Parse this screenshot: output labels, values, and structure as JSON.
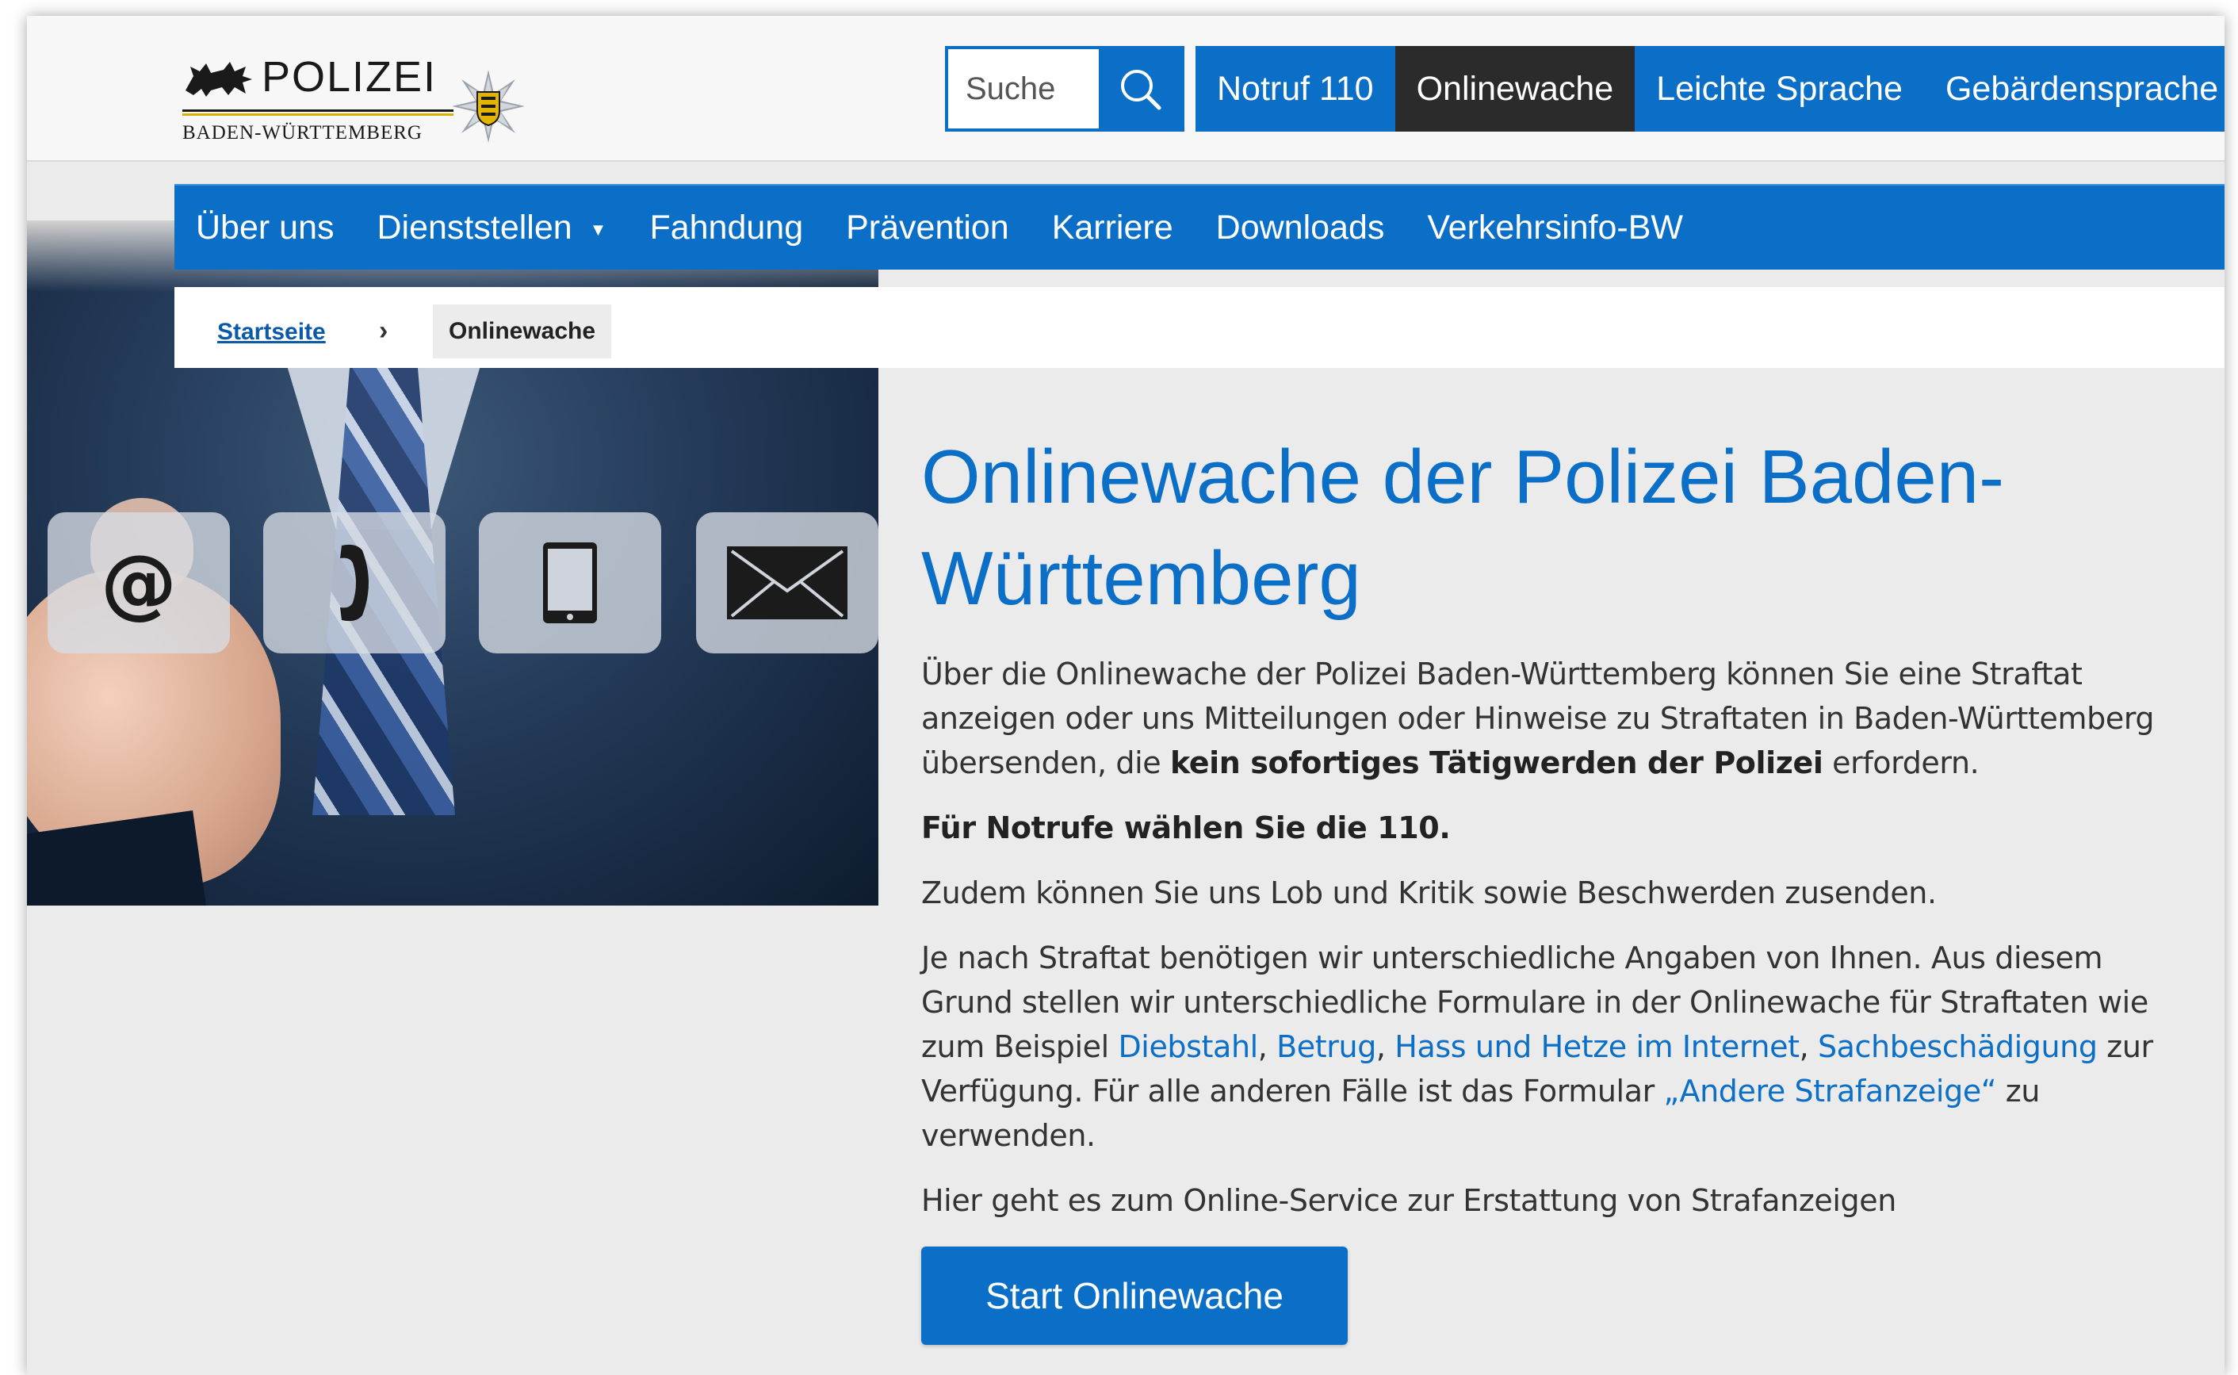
{
  "header": {
    "logo": {
      "word": "POLIZEI",
      "subline": "BADEN-WÜRTTEMBERG"
    },
    "search": {
      "placeholder": "Suche"
    },
    "topnav": [
      {
        "label": "Notruf 110",
        "active": false
      },
      {
        "label": "Onlinewache",
        "active": true
      },
      {
        "label": "Leichte Sprache",
        "active": false
      },
      {
        "label": "Gebärdensprache",
        "active": false
      }
    ]
  },
  "mainnav": [
    {
      "label": "Über uns"
    },
    {
      "label": "Dienststellen",
      "has_dropdown": true
    },
    {
      "label": "Fahndung"
    },
    {
      "label": "Prävention"
    },
    {
      "label": "Karriere"
    },
    {
      "label": "Downloads"
    },
    {
      "label": "Verkehrsinfo-BW"
    }
  ],
  "breadcrumb": {
    "home": "Startseite",
    "separator": "›",
    "current": "Onlinewache"
  },
  "hero": {
    "tiles": [
      "at-icon",
      "phone-icon",
      "tablet-icon",
      "envelope-icon"
    ],
    "at_glyph": "@"
  },
  "content": {
    "title": "Onlinewache der Polizei Baden-Württemberg",
    "p1_start": "Über die Onlinewache der Polizei Baden-Württemberg können Sie eine Straftat anzeigen oder uns Mitteilungen oder Hinweise zu Straftaten in Baden-Württemberg übersenden, die ",
    "p1_bold": "kein sofortiges Tätigwerden der Polizei",
    "p1_end": " erfordern.",
    "p2": "Für Notrufe wählen Sie die 110.",
    "p3": "Zudem können Sie uns Lob und Kritik sowie Beschwerden zusenden.",
    "p4_start": "Je nach Straftat benötigen wir unterschiedliche Angaben von Ihnen. Aus diesem Grund stellen wir unterschiedliche Formulare in der Onlinewache für Straftaten wie zum Beispiel ",
    "links": {
      "diebstahl": "Diebstahl",
      "betrug": "Betrug",
      "hass": "Hass und Hetze im Internet",
      "sachbeschaedigung": "Sachbeschädigung",
      "andere": "„Andere Strafanzeige“"
    },
    "comma": ", ",
    "p4_mid": " zur Verfügung. Für alle anderen Fälle ist das Formular ",
    "p4_end": " zu verwenden.",
    "p5": "Hier geht es zum Online-Service zur Erstattung von Strafanzeigen",
    "start_button": "Start Onlinewache"
  },
  "colors": {
    "brand_blue": "#0b6fc7",
    "active_dark": "#2b2b2b",
    "page_bg": "#ebebeb"
  }
}
